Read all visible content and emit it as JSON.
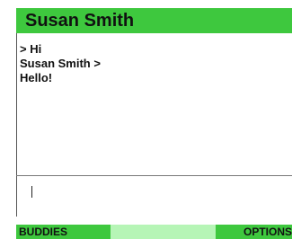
{
  "header": {
    "title": "Susan Smith"
  },
  "chat": {
    "messages": [
      {
        "text": "> Hi"
      },
      {
        "text": "Susan Smith >"
      },
      {
        "text": "Hello!"
      }
    ]
  },
  "input": {
    "value": ""
  },
  "softkeys": {
    "left_label": "BUDDIES",
    "center_label": "",
    "right_label": "OPTIONS"
  },
  "colors": {
    "bar_green": "#3ec83e",
    "center_key_green": "#b6f5b6"
  }
}
